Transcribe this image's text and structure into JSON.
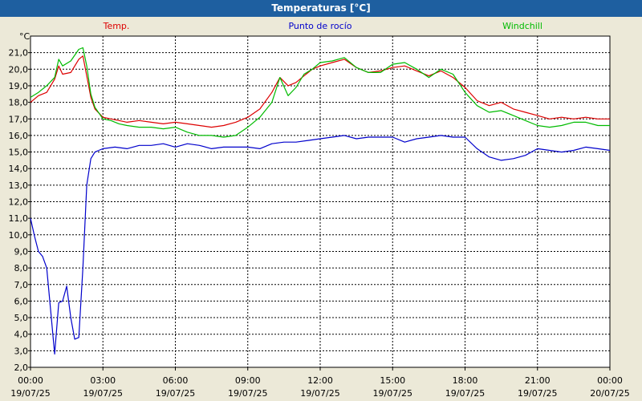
{
  "window": {
    "title": "Temperaturas [°C]"
  },
  "chart_data": {
    "type": "line",
    "title": "Temperaturas [°C]",
    "ylabel": "°C",
    "xlabel": "",
    "ylim": [
      2.0,
      22.0
    ],
    "xlim": [
      0,
      24
    ],
    "grid": true,
    "legend_placement": "top",
    "y_ticks": [
      {
        "value": 2.0,
        "label": "2,0"
      },
      {
        "value": 3.0,
        "label": "3,0"
      },
      {
        "value": 4.0,
        "label": "4,0"
      },
      {
        "value": 5.0,
        "label": "5,0"
      },
      {
        "value": 6.0,
        "label": "6,0"
      },
      {
        "value": 7.0,
        "label": "7,0"
      },
      {
        "value": 8.0,
        "label": "8,0"
      },
      {
        "value": 9.0,
        "label": "9,0"
      },
      {
        "value": 10.0,
        "label": "10,0"
      },
      {
        "value": 11.0,
        "label": "11,0"
      },
      {
        "value": 12.0,
        "label": "12,0"
      },
      {
        "value": 13.0,
        "label": "13,0"
      },
      {
        "value": 14.0,
        "label": "14,0"
      },
      {
        "value": 15.0,
        "label": "15,0"
      },
      {
        "value": 16.0,
        "label": "16,0"
      },
      {
        "value": 17.0,
        "label": "17,0"
      },
      {
        "value": 18.0,
        "label": "18,0"
      },
      {
        "value": 19.0,
        "label": "19,0"
      },
      {
        "value": 20.0,
        "label": "20,0"
      },
      {
        "value": 21.0,
        "label": "21,0"
      }
    ],
    "x_ticks": [
      {
        "value": 0,
        "time": "00:00",
        "date": "19/07/25"
      },
      {
        "value": 3,
        "time": "03:00",
        "date": "19/07/25"
      },
      {
        "value": 6,
        "time": "06:00",
        "date": "19/07/25"
      },
      {
        "value": 9,
        "time": "09:00",
        "date": "19/07/25"
      },
      {
        "value": 12,
        "time": "12:00",
        "date": "19/07/25"
      },
      {
        "value": 15,
        "time": "15:00",
        "date": "19/07/25"
      },
      {
        "value": 18,
        "time": "18:00",
        "date": "19/07/25"
      },
      {
        "value": 21,
        "time": "21:00",
        "date": "19/07/25"
      },
      {
        "value": 24,
        "time": "00:00",
        "date": "20/07/25"
      }
    ],
    "series": [
      {
        "name": "Temp.",
        "color": "#DD0000",
        "x": [
          0,
          0.33,
          0.67,
          1.0,
          1.17,
          1.33,
          1.67,
          2.0,
          2.17,
          2.33,
          2.5,
          2.67,
          3.0,
          3.33,
          3.67,
          4.0,
          4.5,
          5.0,
          5.5,
          6.0,
          6.5,
          7.0,
          7.5,
          8.0,
          8.5,
          9.0,
          9.5,
          10.0,
          10.33,
          10.67,
          11.0,
          11.33,
          11.67,
          12.0,
          12.5,
          13.0,
          13.5,
          14.0,
          14.5,
          15.0,
          15.5,
          16.0,
          16.5,
          17.0,
          17.5,
          18.0,
          18.5,
          19.0,
          19.5,
          20.0,
          20.5,
          21.0,
          21.5,
          22.0,
          22.5,
          23.0,
          23.5,
          24.0
        ],
        "values": [
          18.0,
          18.4,
          18.6,
          19.4,
          20.2,
          19.7,
          19.8,
          20.6,
          20.8,
          19.6,
          18.3,
          17.6,
          17.1,
          17.0,
          16.9,
          16.8,
          16.9,
          16.8,
          16.7,
          16.8,
          16.7,
          16.6,
          16.5,
          16.6,
          16.8,
          17.1,
          17.6,
          18.6,
          19.5,
          19.0,
          19.2,
          19.6,
          20.0,
          20.2,
          20.4,
          20.6,
          20.1,
          19.8,
          19.9,
          20.1,
          20.2,
          19.9,
          19.6,
          19.9,
          19.5,
          18.9,
          18.1,
          17.8,
          18.0,
          17.6,
          17.4,
          17.2,
          17.0,
          17.1,
          17.0,
          17.1,
          17.0,
          17.0
        ]
      },
      {
        "name": "Punto de rocío",
        "color": "#0000CC",
        "x": [
          0,
          0.17,
          0.33,
          0.5,
          0.67,
          0.83,
          1.0,
          1.17,
          1.33,
          1.5,
          1.67,
          1.83,
          2.0,
          2.17,
          2.33,
          2.5,
          2.67,
          2.83,
          3.0,
          3.5,
          4.0,
          4.5,
          5.0,
          5.5,
          6.0,
          6.5,
          7.0,
          7.5,
          8.0,
          8.5,
          9.0,
          9.5,
          10.0,
          10.5,
          11.0,
          11.5,
          12.0,
          12.5,
          13.0,
          13.5,
          14.0,
          14.5,
          15.0,
          15.5,
          16.0,
          16.5,
          17.0,
          17.5,
          18.0,
          18.5,
          19.0,
          19.5,
          20.0,
          20.5,
          21.0,
          21.5,
          22.0,
          22.5,
          23.0,
          23.5,
          24.0
        ],
        "values": [
          11.0,
          9.9,
          9.0,
          8.7,
          8.0,
          5.5,
          2.8,
          5.9,
          6.0,
          6.9,
          5.0,
          3.7,
          3.8,
          8.0,
          13.0,
          14.6,
          15.0,
          15.1,
          15.2,
          15.3,
          15.2,
          15.4,
          15.4,
          15.5,
          15.3,
          15.5,
          15.4,
          15.2,
          15.3,
          15.3,
          15.3,
          15.2,
          15.5,
          15.6,
          15.6,
          15.7,
          15.8,
          15.9,
          16.0,
          15.8,
          15.9,
          15.9,
          15.9,
          15.6,
          15.8,
          15.9,
          16.0,
          15.9,
          15.9,
          15.2,
          14.7,
          14.5,
          14.6,
          14.8,
          15.2,
          15.1,
          15.0,
          15.1,
          15.3,
          15.2,
          15.1
        ]
      },
      {
        "name": "Windchill",
        "color": "#00BB00",
        "x": [
          0,
          0.33,
          0.67,
          1.0,
          1.17,
          1.33,
          1.67,
          2.0,
          2.17,
          2.33,
          2.5,
          2.67,
          3.0,
          3.33,
          3.67,
          4.0,
          4.5,
          5.0,
          5.5,
          6.0,
          6.5,
          7.0,
          7.5,
          8.0,
          8.5,
          9.0,
          9.5,
          10.0,
          10.33,
          10.67,
          11.0,
          11.33,
          11.67,
          12.0,
          12.5,
          13.0,
          13.5,
          14.0,
          14.5,
          15.0,
          15.5,
          16.0,
          16.5,
          17.0,
          17.5,
          18.0,
          18.5,
          19.0,
          19.5,
          20.0,
          20.5,
          21.0,
          21.5,
          22.0,
          22.5,
          23.0,
          23.5,
          24.0
        ],
        "values": [
          18.3,
          18.6,
          19.0,
          19.5,
          20.6,
          20.2,
          20.5,
          21.2,
          21.3,
          20.2,
          18.5,
          17.7,
          17.0,
          16.9,
          16.7,
          16.6,
          16.5,
          16.5,
          16.4,
          16.5,
          16.2,
          16.0,
          16.0,
          15.9,
          16.0,
          16.5,
          17.1,
          18.0,
          19.5,
          18.4,
          18.9,
          19.7,
          20.0,
          20.4,
          20.5,
          20.7,
          20.1,
          19.8,
          19.8,
          20.3,
          20.4,
          20.0,
          19.5,
          20.0,
          19.7,
          18.6,
          17.8,
          17.4,
          17.5,
          17.2,
          16.9,
          16.6,
          16.5,
          16.6,
          16.8,
          16.8,
          16.6,
          16.6
        ]
      }
    ]
  }
}
